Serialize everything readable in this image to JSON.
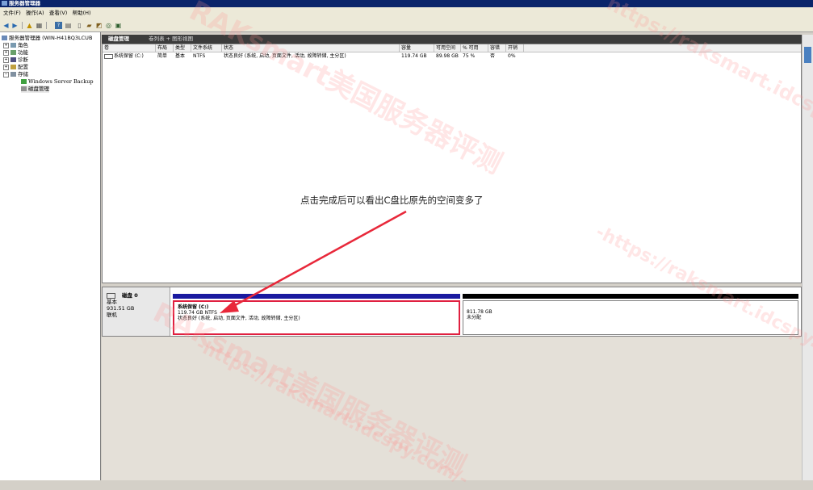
{
  "window": {
    "title": "服务器管理器"
  },
  "menu": [
    "文件(F)",
    "操作(A)",
    "查看(V)",
    "帮助(H)"
  ],
  "tree": {
    "root": "服务器管理器 (WIN-H41BQ3LCUB",
    "items": [
      "角色",
      "功能",
      "诊断",
      "配置",
      "存储"
    ],
    "storage_children": [
      "Windows Server Backup",
      "磁盘管理"
    ]
  },
  "main": {
    "title": "磁盘管理",
    "view_label": "卷列表 + 图形视图"
  },
  "volume_table": {
    "columns": [
      "卷",
      "布局",
      "类型",
      "文件系统",
      "状态",
      "容量",
      "可用空间",
      "% 可用",
      "容错",
      "开销"
    ],
    "rows": [
      [
        "系统保留 (C:)",
        "简单",
        "基本",
        "NTFS",
        "状态良好 (系统, 启动, 页面文件, 活动, 故障转储, 主分区)",
        "119.74 GB",
        "89.98 GB",
        "75 %",
        "否",
        "0%"
      ]
    ]
  },
  "annotation": "点击完成后可以看出C盘比原先的空间变多了",
  "disk": {
    "name": "磁盘 0",
    "type": "基本",
    "size": "931.51 GB",
    "status": "联机",
    "partitions": [
      {
        "name": "系统保留  (C:)",
        "size": "119.74 GB NTFS",
        "status": "状态良好 (系统, 启动, 页面文件, 活动, 故障转储, 主分区)"
      },
      {
        "size": "811.78 GB",
        "status": "未分配"
      }
    ]
  },
  "watermarks": [
    "RAKsmart美国服务器评测",
    "https://raksmart.idcspy.com/",
    "-https://raksmart.idcspy.com/-",
    "RAKsmart美国服务器评测",
    "-https://raksmart.idcspy.com/-"
  ],
  "colors": {
    "title_bar": "#0a246a",
    "accent_red": "#e02040",
    "primary_bar": "#1a1aa0",
    "unalloc_bar": "#000000"
  }
}
